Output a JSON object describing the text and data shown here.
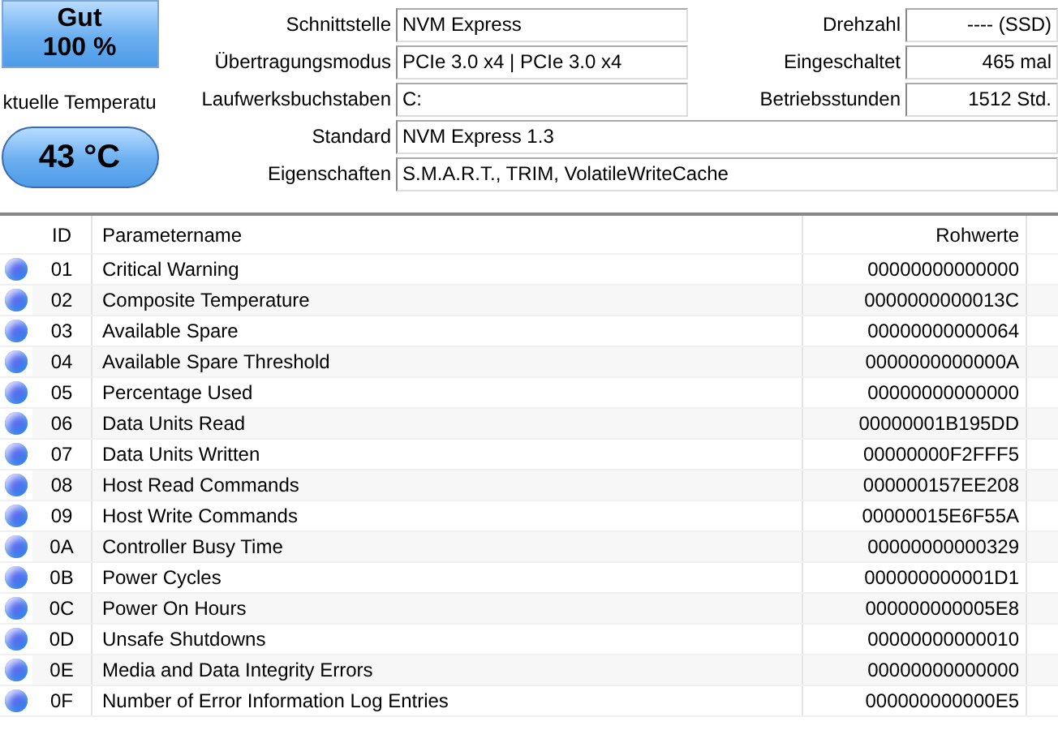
{
  "health": {
    "label": "Gut",
    "percent": "100 %"
  },
  "temperature": {
    "label": "ktuelle Temperatu",
    "value": "43 °C"
  },
  "info_left": [
    {
      "label": "Schnittstelle",
      "value": "NVM Express"
    },
    {
      "label": "Übertragungsmodus",
      "value": "PCIe 3.0 x4 | PCIe 3.0 x4"
    },
    {
      "label": "Laufwerksbuchstaben",
      "value": "C:"
    }
  ],
  "info_right": [
    {
      "label": "Drehzahl",
      "value": "---- (SSD)"
    },
    {
      "label": "Eingeschaltet",
      "value": "465 mal"
    },
    {
      "label": "Betriebsstunden",
      "value": "1512 Std."
    }
  ],
  "info_wide": [
    {
      "label": "Standard",
      "value": "NVM Express 1.3"
    },
    {
      "label": "Eigenschaften",
      "value": "S.M.A.R.T., TRIM, VolatileWriteCache"
    }
  ],
  "table": {
    "columns": [
      "ID",
      "Parametername",
      "Rohwerte"
    ],
    "rows": [
      {
        "color": "#5a6cf0",
        "id": "01",
        "name": "Critical Warning",
        "raw": "00000000000000"
      },
      {
        "color": "#5a6cf0",
        "id": "02",
        "name": "Composite Temperature",
        "raw": "0000000000013C"
      },
      {
        "color": "#5a6cf0",
        "id": "03",
        "name": "Available Spare",
        "raw": "00000000000064"
      },
      {
        "color": "#5a6cf0",
        "id": "04",
        "name": "Available Spare Threshold",
        "raw": "0000000000000A"
      },
      {
        "color": "#5a6cf0",
        "id": "05",
        "name": "Percentage Used",
        "raw": "00000000000000"
      },
      {
        "color": "#5a6cf0",
        "id": "06",
        "name": "Data Units Read",
        "raw": "00000001B195DD"
      },
      {
        "color": "#5a6cf0",
        "id": "07",
        "name": "Data Units Written",
        "raw": "00000000F2FFF5"
      },
      {
        "color": "#5a6cf0",
        "id": "08",
        "name": "Host Read Commands",
        "raw": "000000157EE208"
      },
      {
        "color": "#5a6cf0",
        "id": "09",
        "name": "Host Write Commands",
        "raw": "00000015E6F55A"
      },
      {
        "color": "#5a6cf0",
        "id": "0A",
        "name": "Controller Busy Time",
        "raw": "00000000000329"
      },
      {
        "color": "#5a6cf0",
        "id": "0B",
        "name": "Power Cycles",
        "raw": "000000000001D1"
      },
      {
        "color": "#5a6cf0",
        "id": "0C",
        "name": "Power On Hours",
        "raw": "000000000005E8"
      },
      {
        "color": "#5a6cf0",
        "id": "0D",
        "name": "Unsafe Shutdowns",
        "raw": "00000000000010"
      },
      {
        "color": "#5a6cf0",
        "id": "0E",
        "name": "Media and Data Integrity Errors",
        "raw": "00000000000000"
      },
      {
        "color": "#5a6cf0",
        "id": "0F",
        "name": "Number of Error Information Log Entries",
        "raw": "000000000000E5"
      }
    ]
  }
}
